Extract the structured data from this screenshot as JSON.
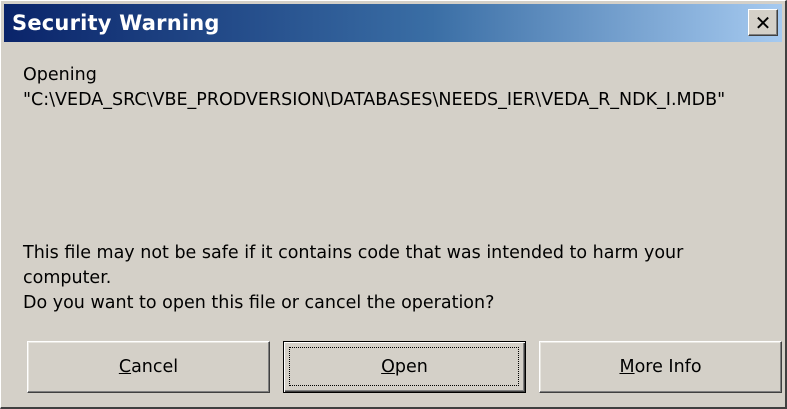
{
  "window": {
    "title": "Security Warning",
    "close_glyph": "✕"
  },
  "message": {
    "opening_label": "Opening",
    "file_path": "\"C:\\VEDA_SRC\\VBE_PRODVERSION\\DATABASES\\NEEDS_IER\\VEDA_R_NDK_I.MDB\"",
    "warning": "This file may not be safe if it contains code that was intended to harm your computer.",
    "question": "Do you want to open this file or cancel the operation?"
  },
  "buttons": {
    "cancel": {
      "mnemonic": "C",
      "rest": "ancel"
    },
    "open": {
      "mnemonic": "O",
      "rest": "pen"
    },
    "more_info": {
      "before": "",
      "mnemonic": "M",
      "rest": "ore Info"
    }
  }
}
